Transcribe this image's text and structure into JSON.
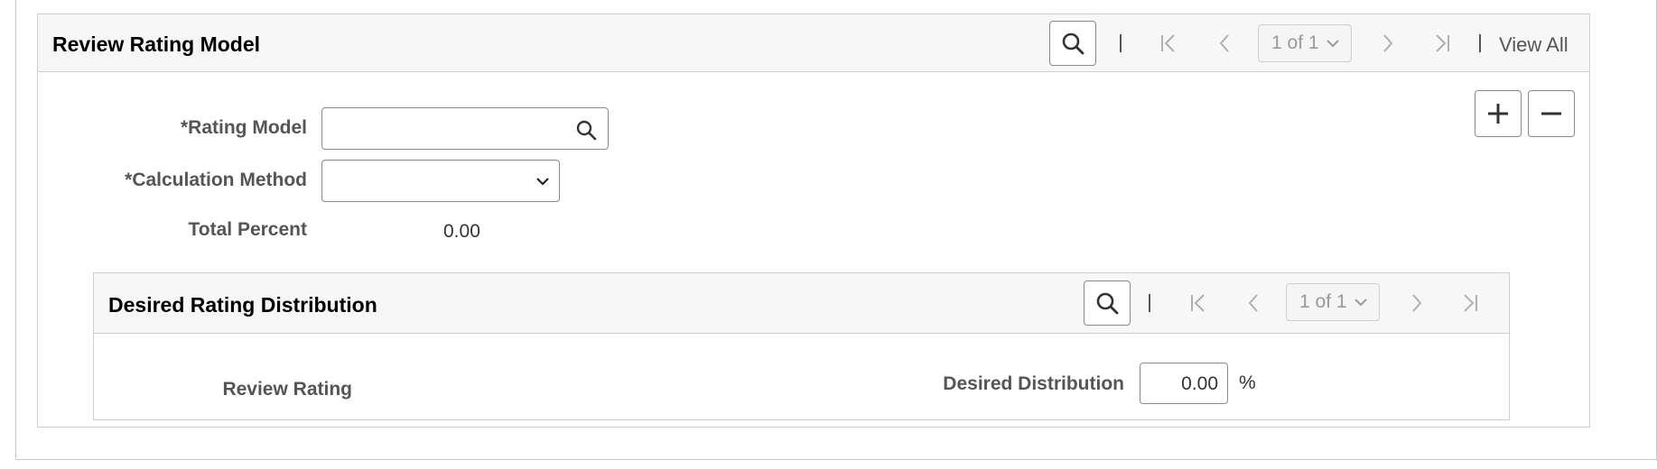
{
  "review_rating_model": {
    "title": "Review Rating Model",
    "pager": {
      "page_label": "1 of 1",
      "view_all": "View All"
    },
    "fields": {
      "rating_model": {
        "label": "*Rating Model",
        "value": ""
      },
      "calculation_method": {
        "label": "*Calculation Method",
        "value": ""
      },
      "total_percent": {
        "label": "Total Percent",
        "value": "0.00"
      }
    },
    "buttons": {
      "add_icon": "plus-icon",
      "delete_icon": "minus-icon"
    }
  },
  "desired_rating_distribution": {
    "title": "Desired Rating Distribution",
    "pager": {
      "page_label": "1 of 1"
    },
    "fields": {
      "review_rating": {
        "label": "Review Rating"
      },
      "desired_distribution": {
        "label": "Desired Distribution",
        "value": "0.00",
        "unit": "%"
      }
    }
  },
  "colors": {
    "header_bg": "#f7f7f7",
    "border": "#cfcfcf",
    "label_text": "#555555",
    "disabled_text": "#9a9a9a"
  }
}
